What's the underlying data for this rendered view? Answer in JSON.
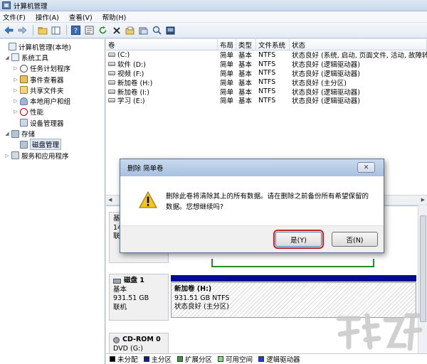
{
  "window": {
    "title": "计算机管理"
  },
  "menu": [
    "文件(F)",
    "操作(A)",
    "查看(V)",
    "帮助(H)"
  ],
  "toolbar": {
    "icons": [
      "back-arrow-icon",
      "forward-arrow-icon",
      "up-folder-icon",
      "show-hide-tree-icon",
      "help-icon",
      "properties-icon",
      "refresh-icon",
      "delete-icon",
      "open-icon",
      "export-icon",
      "zoom-icon",
      "console-icon"
    ]
  },
  "tree": {
    "root": "计算机管理(本地)",
    "system_tools": "系统工具",
    "task_scheduler": "任务计划程序",
    "event_viewer": "事件查看器",
    "shared_folders": "共享文件夹",
    "local_users": "本地用户和组",
    "performance": "性能",
    "device_manager": "设备管理器",
    "storage": "存储",
    "disk_management": "磁盘管理",
    "services": "服务和应用程序"
  },
  "volume_list": {
    "headers": [
      "卷",
      "布局",
      "类型",
      "文件系统",
      "状态"
    ],
    "rows": [
      [
        "(C:)",
        "简单",
        "基本",
        "NTFS",
        "状态良好 (系统, 启动, 页面文件, 活动, 故障转储"
      ],
      [
        "软件 (D:)",
        "简单",
        "基本",
        "NTFS",
        "状态良好 (逻辑驱动器)"
      ],
      [
        "视频 (F:)",
        "简单",
        "基本",
        "NTFS",
        "状态良好 (逻辑驱动器)"
      ],
      [
        "新加卷 (H:)",
        "简单",
        "基本",
        "NTFS",
        "状态良好 (主分区)"
      ],
      [
        "新加卷 (I:)",
        "简单",
        "基本",
        "NTFS",
        "状态良好 (逻辑驱动器)"
      ],
      [
        "学习 (E:)",
        "简单",
        "基本",
        "NTFS",
        "状态良好 (逻辑驱动器)"
      ]
    ]
  },
  "graph": {
    "disk0": {
      "l1": "基本",
      "l2": "14",
      "l3": "联机"
    },
    "disk1": {
      "name": "磁盘 1",
      "type": "基本",
      "size": "931.51 GB",
      "status": "联机",
      "partition": {
        "name": "新加卷  (H:)",
        "size": "931.51 GB NTFS",
        "status": "状态良好 (主分区)"
      }
    },
    "cdrom": {
      "name": "CD-ROM 0",
      "drive": "DVD (G:)"
    }
  },
  "legend": [
    {
      "label": "未分配",
      "color": "#000000"
    },
    {
      "label": "主分区",
      "color": "#0a1e8c"
    },
    {
      "label": "扩展分区",
      "color": "#3a9a3a"
    },
    {
      "label": "可用空间",
      "color": "#7fe07f"
    },
    {
      "label": "逻辑驱动器",
      "color": "#1a3cdc"
    }
  ],
  "dialog": {
    "title": "删除 简单卷",
    "message": "删除此卷将清除其上的所有数据。请在删除之前备份所有希望保留的数据。您想继续吗?",
    "yes": "是(Y)",
    "no": "否(N)",
    "close_glyph": "✕",
    "icon": "warning-icon"
  }
}
